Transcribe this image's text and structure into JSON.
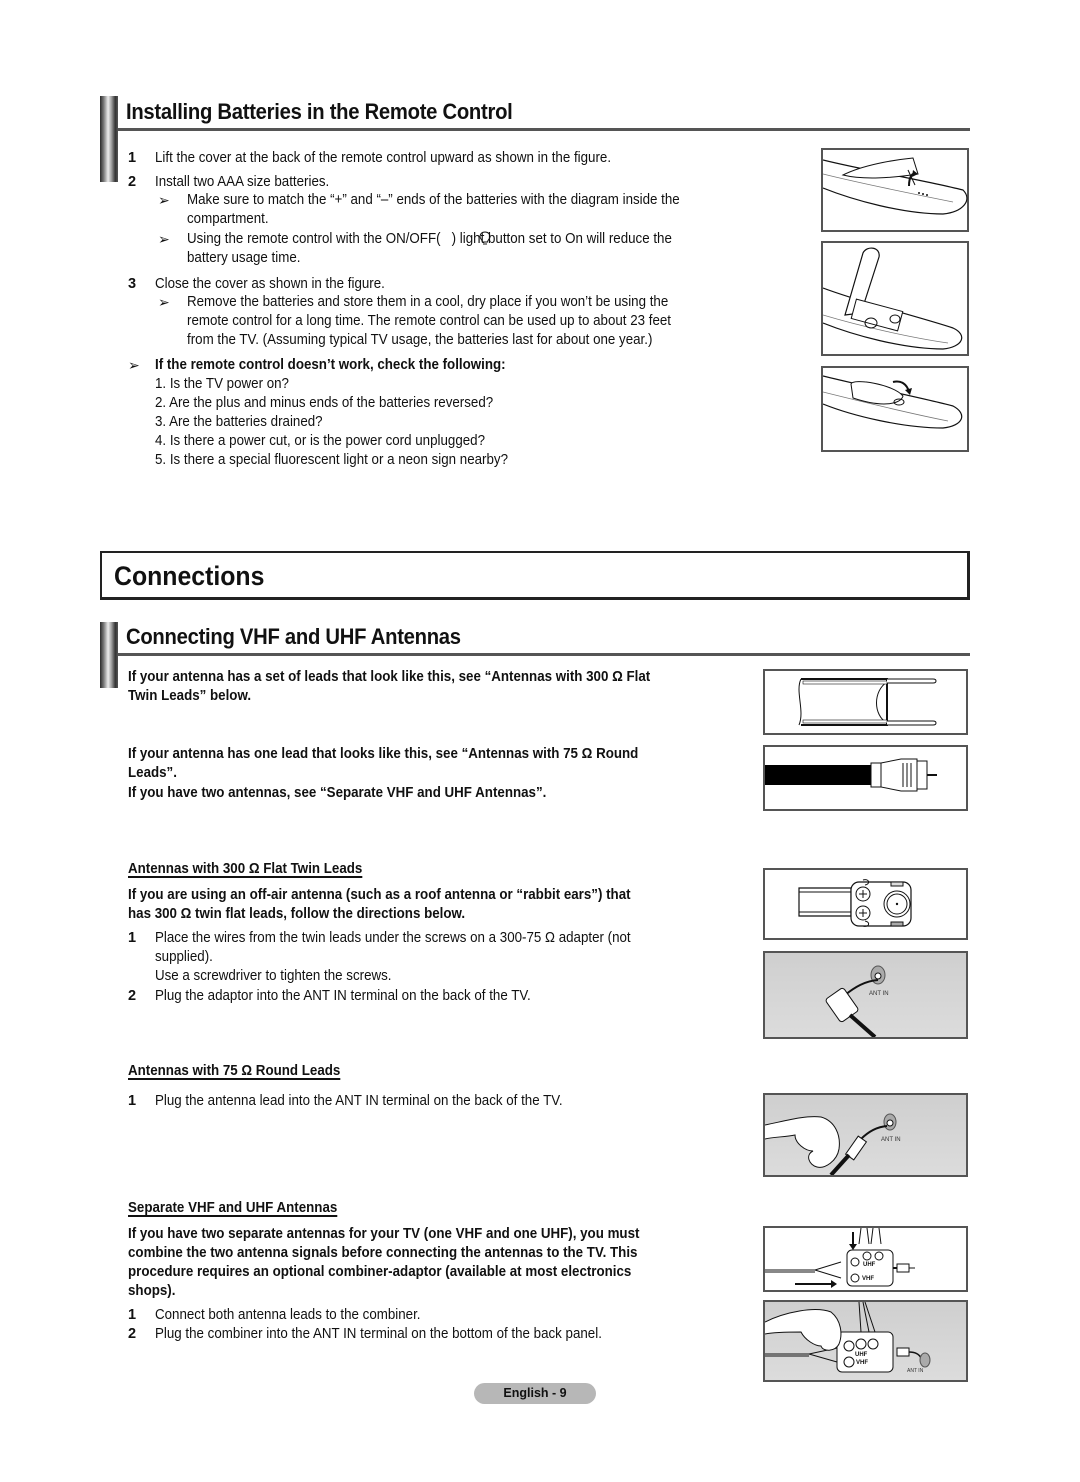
{
  "batteries": {
    "heading": "Installing Batteries in the Remote Control",
    "steps": [
      {
        "num": "1",
        "text": "Lift the cover at the back of the remote control upward as shown in the figure."
      },
      {
        "num": "2",
        "text": "Install two AAA size batteries."
      },
      {
        "num": "3",
        "text": "Close the cover as shown in the figure."
      }
    ],
    "notes_step2": [
      {
        "lines": [
          "Make sure to match the “+” and “–” ends of the batteries with the diagram inside the",
          "compartment."
        ]
      },
      {
        "lines": [
          "Using the remote control with the ON/OFF(   ) light button set to On will reduce the",
          "battery usage time."
        ]
      }
    ],
    "note_step3": {
      "lines": [
        "Remove the batteries and store them in a cool, dry place if you won’t be using the",
        "remote control for a long time. The remote control can be used up to about 23 feet",
        "from the TV. (Assuming typical TV usage, the batteries last for about one year.)"
      ]
    },
    "troubleshoot": {
      "heading": "If the remote control doesn’t work, check the following:",
      "items": [
        "1. Is the TV power on?",
        "2. Are the plus and minus ends of the batteries reversed?",
        "3. Are the batteries drained?",
        "4. Is there a power cut, or is the power cord unplugged?",
        "5. Is there a special fluorescent light or a neon sign nearby?"
      ]
    },
    "note_arrow": "➢",
    "light_icon": "lightbulb-icon"
  },
  "connections": {
    "title": "Connections"
  },
  "antennas": {
    "heading": "Connecting VHF and UHF Antennas",
    "intro": [
      {
        "lines": [
          "If your antenna has a set of leads that look like this, see “Antennas with 300 Ω Flat",
          "Twin Leads” below."
        ]
      },
      {
        "lines": [
          "If your antenna has one lead that looks like this, see “Antennas with 75 Ω Round",
          "Leads”."
        ]
      },
      {
        "lines": [
          "If you have two antennas, see “Separate VHF and UHF Antennas”."
        ]
      }
    ],
    "flat_twin": {
      "heading": "Antennas with 300 Ω Flat Twin Leads",
      "intro_lines": [
        "If you are using an off-air antenna (such as a roof antenna or “rabbit ears”) that",
        "has 300 Ω twin flat leads, follow the directions below."
      ],
      "steps": [
        {
          "num": "1",
          "lines": [
            "Place the wires from the twin leads under the screws on a 300-75 Ω adapter (not",
            "supplied).",
            "Use a screwdriver to tighten the screws."
          ]
        },
        {
          "num": "2",
          "lines": [
            "Plug the adaptor into the ANT IN terminal on the back of the TV."
          ]
        }
      ],
      "figure_label": "ANT IN"
    },
    "round": {
      "heading": "Antennas with 75 Ω Round Leads",
      "steps": [
        {
          "num": "1",
          "lines": [
            "Plug the antenna lead into the ANT IN terminal on the back of the TV."
          ]
        }
      ],
      "figure_label": "ANT IN"
    },
    "separate": {
      "heading": "Separate VHF and UHF Antennas",
      "intro_lines": [
        "If you have two separate antennas for your TV (one VHF and one UHF), you must",
        "combine the two antenna signals before connecting the antennas to the TV. This",
        "procedure requires an optional combiner-adaptor (available at most electronics",
        "shops)."
      ],
      "steps": [
        {
          "num": "1",
          "lines": [
            "Connect both antenna leads to the combiner."
          ]
        },
        {
          "num": "2",
          "lines": [
            "Plug the combiner into the ANT IN terminal on the bottom of the back panel."
          ]
        }
      ],
      "figure_labels": {
        "uhf": "UHF",
        "vhf": "VHF",
        "ant_in": "ANT IN"
      }
    }
  },
  "footer": {
    "page_label": "English - 9"
  }
}
